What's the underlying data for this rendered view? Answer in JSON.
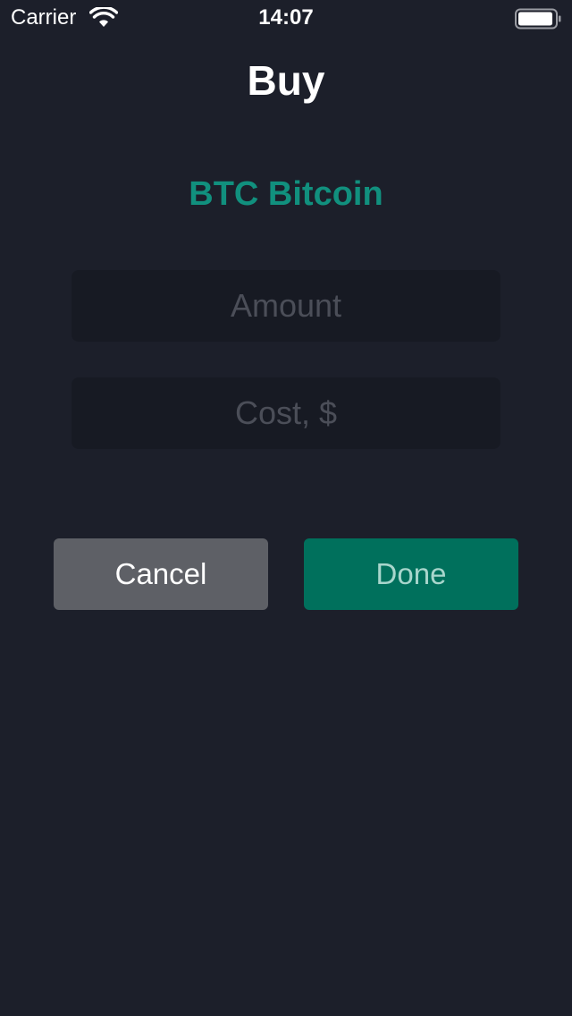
{
  "status_bar": {
    "carrier": "Carrier",
    "time": "14:07",
    "wifi_icon": "wifi-icon",
    "battery_icon": "battery-icon"
  },
  "header": {
    "title": "Buy"
  },
  "asset": {
    "title": "BTC Bitcoin"
  },
  "form": {
    "amount": {
      "value": "",
      "placeholder": "Amount"
    },
    "cost": {
      "value": "",
      "placeholder": "Cost, $"
    }
  },
  "actions": {
    "cancel_label": "Cancel",
    "done_label": "Done"
  },
  "colors": {
    "background": "#1c1f2a",
    "accent": "#11907e",
    "field_background": "#171a23",
    "placeholder": "#4b4e58",
    "cancel_background": "#5e6066",
    "done_background": "#00705c",
    "done_text": "#a8d6cc"
  }
}
